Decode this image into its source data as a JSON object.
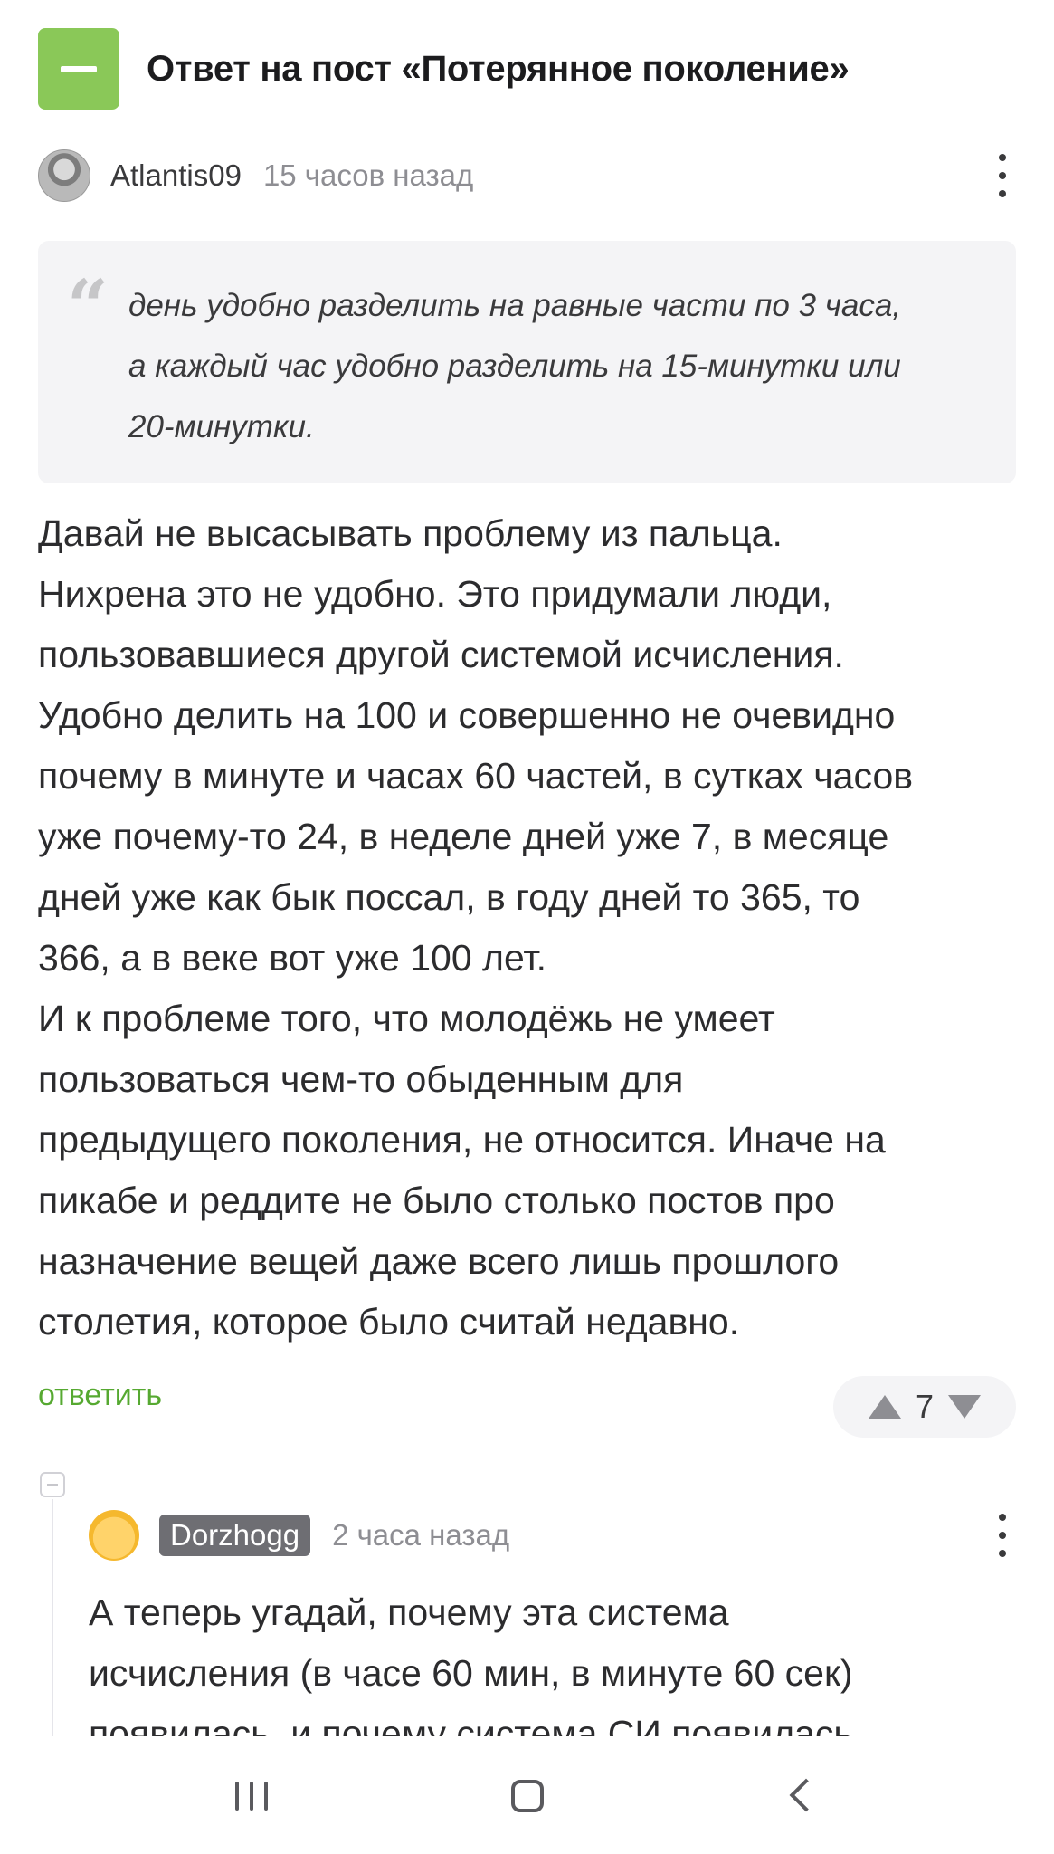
{
  "post": {
    "title": "Ответ на пост «Потерянное поколение»"
  },
  "comment": {
    "username": "Atlantis09",
    "timestamp": "15 часов назад",
    "quote_lines": [
      "день удобно разделить на равные части по 3 часа,",
      "а каждый час удобно разделить на 15-минутки или",
      "20-минутки."
    ],
    "body_lines": [
      "Давай не высасывать проблему из пальца.",
      "Нихрена это не удобно. Это придумали люди,",
      "пользовавшиеся другой системой исчисления.",
      "Удобно делить на 100 и совершенно не очевидно",
      "почему в минуте и часах 60 частей, в сутках часов",
      "уже почему-то 24, в неделе дней уже 7, в месяце",
      "дней уже как бык поссал, в году дней то 365, то",
      "366, а в веке вот уже 100 лет.",
      "И к проблеме того, что молодёжь не умеет",
      "пользоваться чем-то обыденным для",
      "предыдущего поколения, не относится. Иначе на",
      "пикабе и реддите не было столько постов про",
      "назначение вещей даже всего лишь прошлого",
      "столетия, которое было считай недавно."
    ],
    "reply_label": "ответить",
    "vote_count": "7"
  },
  "reply": {
    "username": "Dorzhogg",
    "timestamp": "2 часа назад",
    "body_lines": [
      "А теперь угадай, почему эта система",
      "исчисления (в часе 60 мин, в минуте 60 сек)",
      "появилась, и почему система СИ появилась"
    ]
  },
  "colors": {
    "accent_green": "#8ac858",
    "link_green": "#56a931"
  },
  "icons": {
    "collapse": "minus-icon",
    "quote": "quote-icon",
    "more": "more-vertical-icon",
    "upvote": "triangle-up-icon",
    "downvote": "triangle-down-icon",
    "nav_recent": "recent-apps-icon",
    "nav_home": "home-icon",
    "nav_back": "back-icon"
  }
}
